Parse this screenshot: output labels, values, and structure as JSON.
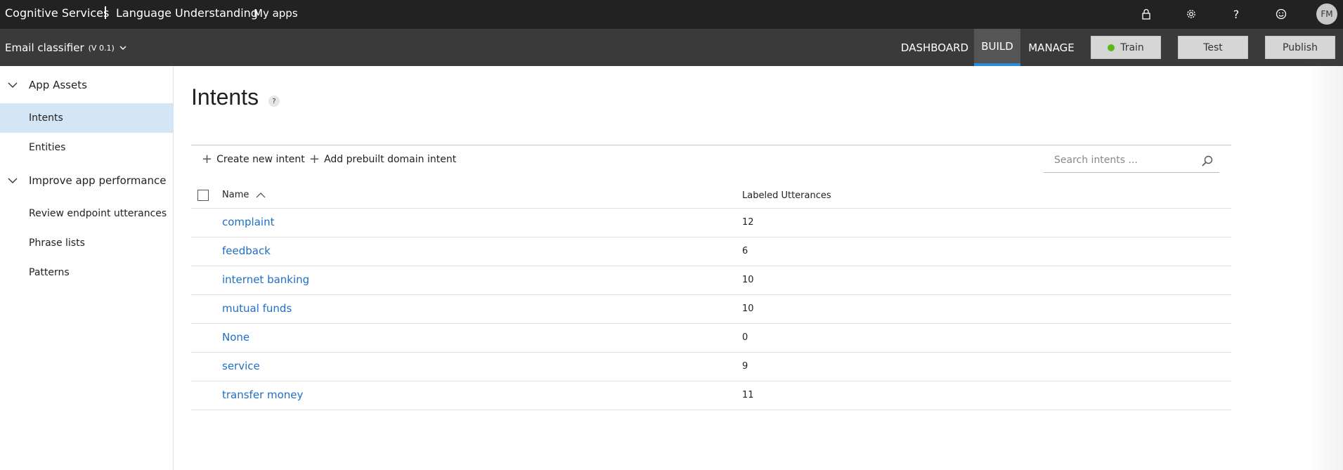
{
  "topbar": {
    "brand": "Cognitive Services",
    "product": "Language Understanding",
    "my_apps": "My apps",
    "icons": [
      "lock-icon",
      "gear-icon",
      "help-icon",
      "smiley-icon"
    ],
    "avatar_initials": "FM"
  },
  "appbar": {
    "app_name": "Email classifier",
    "version": "(V 0.1)",
    "tabs": [
      {
        "label": "DASHBOARD",
        "active": false
      },
      {
        "label": "BUILD",
        "active": true
      },
      {
        "label": "MANAGE",
        "active": false
      }
    ],
    "buttons": {
      "train": "Train",
      "test": "Test",
      "publish": "Publish"
    },
    "train_status_color": "#5cb815",
    "accent_color": "#2a8bd8"
  },
  "sidebar": {
    "groups": [
      {
        "label": "App Assets",
        "items": [
          {
            "label": "Intents",
            "active": true
          },
          {
            "label": "Entities",
            "active": false
          }
        ]
      },
      {
        "label": "Improve app performance",
        "items": [
          {
            "label": "Review endpoint utterances",
            "active": false
          },
          {
            "label": "Phrase lists",
            "active": false
          },
          {
            "label": "Patterns",
            "active": false
          }
        ]
      }
    ]
  },
  "main": {
    "title": "Intents",
    "help_badge": "?",
    "toolbar": {
      "create": "Create new intent",
      "add_prebuilt": "Add prebuilt domain intent",
      "search_placeholder": "Search intents ..."
    },
    "table": {
      "columns": [
        "Name",
        "Labeled Utterances"
      ],
      "rows": [
        {
          "name": "complaint",
          "count": "12"
        },
        {
          "name": "feedback",
          "count": "6"
        },
        {
          "name": "internet banking",
          "count": "10"
        },
        {
          "name": "mutual funds",
          "count": "10"
        },
        {
          "name": "None",
          "count": "0"
        },
        {
          "name": "service",
          "count": "9"
        },
        {
          "name": "transfer money",
          "count": "11"
        }
      ]
    }
  }
}
